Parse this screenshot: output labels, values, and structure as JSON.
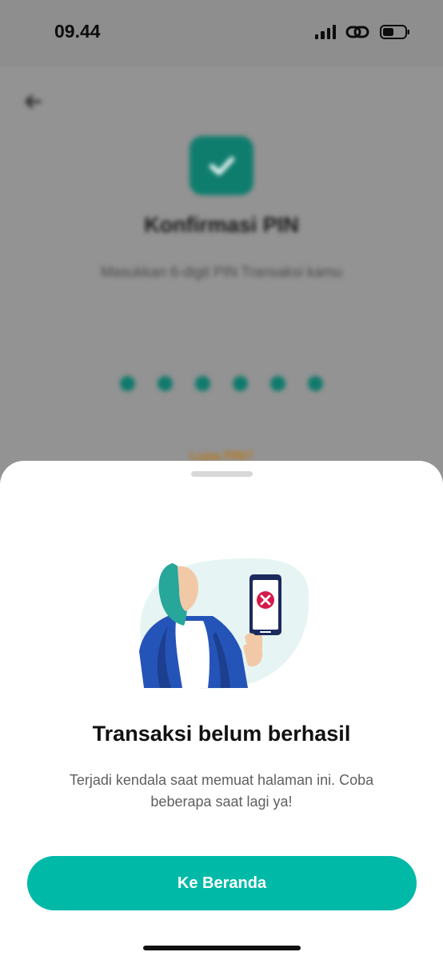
{
  "status_bar": {
    "time": "09.44",
    "icons": [
      "cellular-signal-icon",
      "link-icon",
      "battery-icon"
    ]
  },
  "background_screen": {
    "title": "Konfirmasi PIN",
    "subtitle": "Masukkan 6-digit PIN Transaksi kamu",
    "pin_digits_entered": 6,
    "forgot_pin_label": "Lupa PIN?",
    "icons": [
      "back-arrow-icon",
      "check-icon"
    ],
    "accent_color": "#0f7d6e"
  },
  "sheet": {
    "title": "Transaksi belum berhasil",
    "message": "Terjadi kendala saat memuat halaman ini. Coba beberapa saat lagi ya!",
    "button_label": "Ke Beranda",
    "button_color": "#00b9a7",
    "illustration_icon": "failed-transaction-illustration",
    "error_color": "#d41a4a"
  }
}
